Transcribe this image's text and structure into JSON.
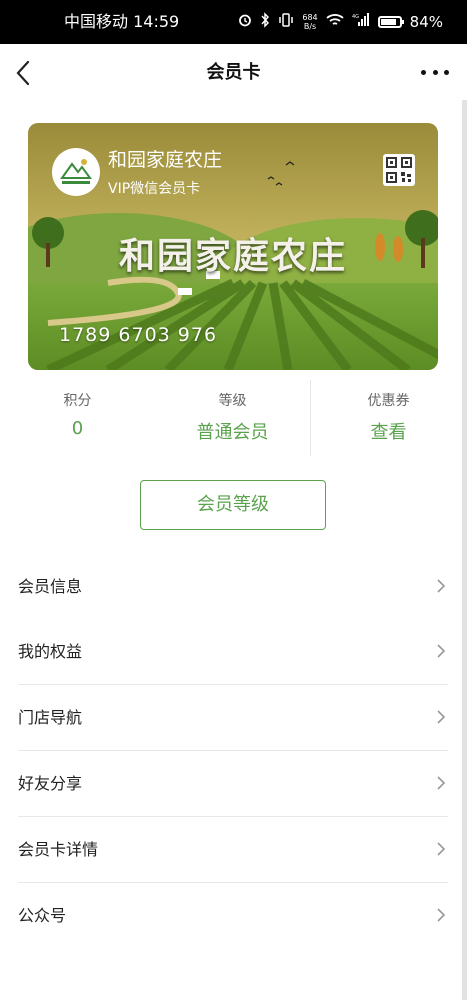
{
  "status_bar": {
    "carrier_time": "中国移动 14:59",
    "net_speed_value": "684",
    "net_speed_unit": "B/s",
    "network_type": "4G",
    "battery_percent": "84%",
    "battery_level": 0.84
  },
  "nav": {
    "title": "会员卡"
  },
  "card": {
    "store_name": "和园家庭农庄",
    "card_type": "VIP微信会员卡",
    "big_title": "和园家庭农庄",
    "card_number": "1789 6703 976",
    "logo_text": "和园家庭农庄"
  },
  "stats": [
    {
      "label": "积分",
      "value": "0"
    },
    {
      "label": "等级",
      "value": "普通会员"
    },
    {
      "label": "优惠券",
      "value": "查看"
    }
  ],
  "level_button": "会员等级",
  "menu": [
    {
      "label": "会员信息"
    },
    {
      "label": "我的权益"
    },
    {
      "label": "门店导航"
    },
    {
      "label": "好友分享"
    },
    {
      "label": "会员卡详情"
    },
    {
      "label": "公众号"
    }
  ],
  "colors": {
    "accent": "#5aa24d",
    "status_bar_bg": "#000000"
  }
}
